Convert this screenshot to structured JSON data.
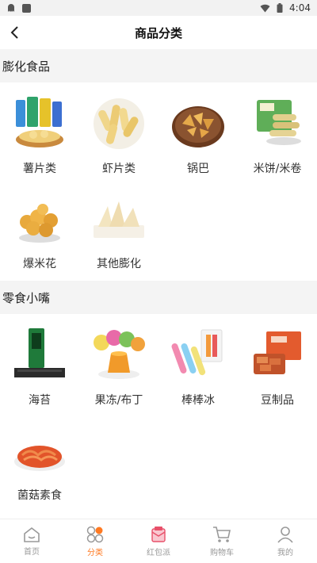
{
  "status_bar": {
    "time": "4:04"
  },
  "header": {
    "title": "商品分类"
  },
  "sections": [
    {
      "title": "膨化食品",
      "items": [
        {
          "label": "薯片类",
          "icon": "chips-bag-icon"
        },
        {
          "label": "虾片类",
          "icon": "shrimp-chips-bowl-icon"
        },
        {
          "label": "锅巴",
          "icon": "guoba-crackers-icon"
        },
        {
          "label": "米饼/米卷",
          "icon": "rice-roll-icon"
        },
        {
          "label": "爆米花",
          "icon": "popcorn-bowl-icon"
        },
        {
          "label": "其他膨化",
          "icon": "puffed-snack-icon"
        }
      ]
    },
    {
      "title": "零食小嘴",
      "items": [
        {
          "label": "海苔",
          "icon": "seaweed-pack-icon"
        },
        {
          "label": "果冻/布丁",
          "icon": "jelly-pudding-icon"
        },
        {
          "label": "棒棒冰",
          "icon": "ice-pop-icon"
        },
        {
          "label": "豆制品",
          "icon": "tofu-snack-icon"
        },
        {
          "label": "菌菇素食",
          "icon": "mushroom-snack-icon"
        }
      ]
    }
  ],
  "tabbar": [
    {
      "label": "首页",
      "icon": "home-icon",
      "active": false
    },
    {
      "label": "分类",
      "icon": "category-icon",
      "active": true
    },
    {
      "label": "红包派",
      "icon": "red-packet-icon",
      "active": false
    },
    {
      "label": "购物车",
      "icon": "cart-icon",
      "active": false
    },
    {
      "label": "我的",
      "icon": "profile-icon",
      "active": false
    }
  ],
  "colors": {
    "accent": "#ff7a22",
    "section_bg": "#f4f4f4",
    "tab_inactive": "#999999"
  }
}
